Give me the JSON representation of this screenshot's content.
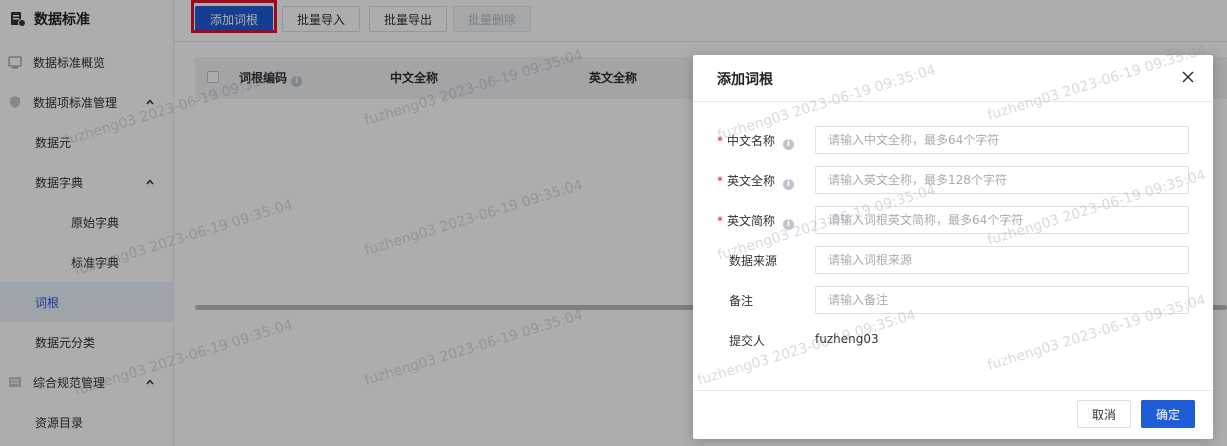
{
  "sidebar": {
    "title": "数据标准",
    "items": [
      {
        "label": "数据标准概览",
        "icon": "dashboard-icon"
      },
      {
        "label": "数据项标准管理",
        "icon": "shield-icon"
      },
      {
        "label": "数据元"
      },
      {
        "label": "数据字典"
      },
      {
        "label": "原始字典"
      },
      {
        "label": "标准字典"
      },
      {
        "label": "词根"
      },
      {
        "label": "数据元分类"
      },
      {
        "label": "综合规范管理",
        "icon": "list-icon"
      },
      {
        "label": "资源目录"
      }
    ]
  },
  "toolbar": {
    "add_label": "添加词根",
    "import_label": "批量导入",
    "export_label": "批量导出",
    "delete_label": "批量删除"
  },
  "table": {
    "columns": [
      "词根编码",
      "中文全称",
      "英文全称"
    ]
  },
  "dialog": {
    "title": "添加词根",
    "fields": [
      {
        "label": "中文名称",
        "required": true,
        "placeholder": "请输入中文全称，最多64个字符"
      },
      {
        "label": "英文全称",
        "required": true,
        "placeholder": "请输入英文全称，最多128个字符"
      },
      {
        "label": "英文简称",
        "required": true,
        "placeholder": "请输入词根英文简称，最多64个字符"
      },
      {
        "label": "数据来源",
        "required": false,
        "placeholder": "请输入词根来源"
      },
      {
        "label": "备注",
        "required": false,
        "placeholder": "请输入备注"
      }
    ],
    "submitter_label": "提交人",
    "submitter_value": "fuzheng03",
    "cancel_label": "取消",
    "confirm_label": "确定"
  },
  "watermark": "fuzheng03 2023-06-19 09:35:04",
  "colors": {
    "primary": "#1f5cd6",
    "highlight": "#e8102e",
    "required": "#e8102e"
  }
}
